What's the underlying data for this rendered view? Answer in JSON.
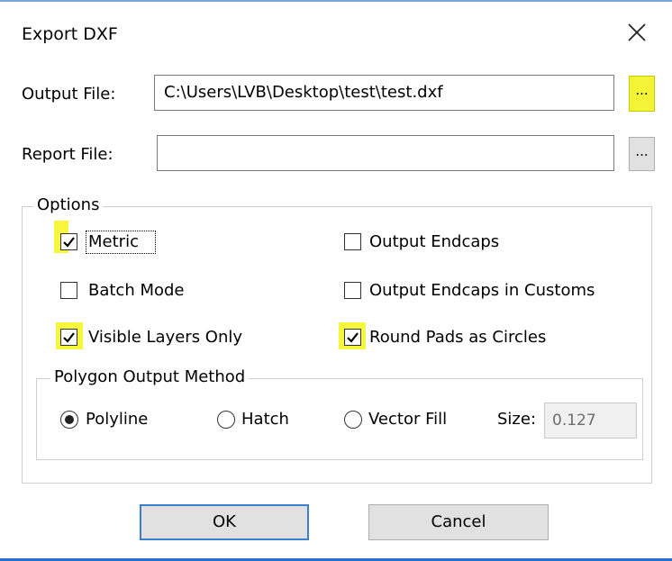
{
  "window": {
    "title": "Export DXF"
  },
  "output_file": {
    "label": "Output File:",
    "value": "C:\\Users\\LVB\\Desktop\\test\\test.dxf",
    "browse_label": "..."
  },
  "report_file": {
    "label": "Report File:",
    "value": "",
    "browse_label": "..."
  },
  "options": {
    "title": "Options",
    "metric": {
      "label": "Metric",
      "checked": true
    },
    "batch_mode": {
      "label": "Batch Mode",
      "checked": false
    },
    "visible_layers_only": {
      "label": "Visible Layers Only",
      "checked": true
    },
    "output_endcaps": {
      "label": "Output Endcaps",
      "checked": false
    },
    "output_endcaps_customs": {
      "label": "Output Endcaps in Customs",
      "checked": false
    },
    "round_pads_circles": {
      "label": "Round Pads as Circles",
      "checked": true
    }
  },
  "polygon": {
    "title": "Polygon Output Method",
    "polyline": {
      "label": "Polyline",
      "selected": true
    },
    "hatch": {
      "label": "Hatch",
      "selected": false
    },
    "vector_fill": {
      "label": "Vector Fill",
      "selected": false
    },
    "size_label": "Size:",
    "size_value": "0.127"
  },
  "buttons": {
    "ok": "OK",
    "cancel": "Cancel"
  },
  "colors": {
    "highlight": "#f6f63c",
    "accent": "#3c7fd1",
    "border_bottom": "#2a6fd0"
  }
}
